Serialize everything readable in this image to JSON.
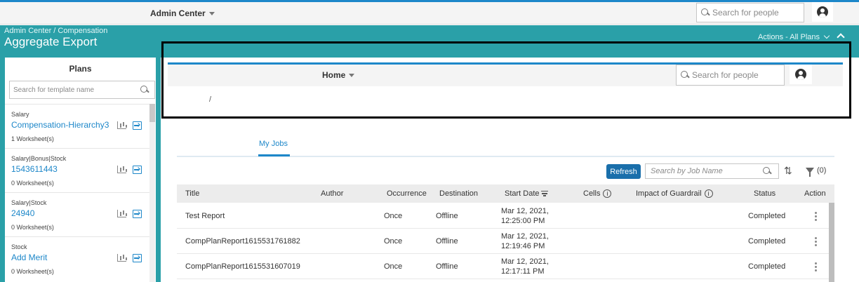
{
  "shell": {
    "title": "Admin Center",
    "search_placeholder": "Search for people"
  },
  "header": {
    "breadcrumb": "Admin Center / Compensation",
    "title": "Aggregate Export",
    "actions_label": "Actions - All Plans"
  },
  "plans": {
    "title": "Plans",
    "search_placeholder": "Search for template name",
    "items": [
      {
        "category": "Salary",
        "name": "Compensation-Hierarchy3",
        "worksheets": "1 Worksheet(s)"
      },
      {
        "category": "Salary|Bonus|Stock",
        "name": "1543611443",
        "worksheets": "0 Worksheet(s)"
      },
      {
        "category": "Salary|Stock",
        "name": "24940",
        "worksheets": "0 Worksheet(s)"
      },
      {
        "category": "Stock",
        "name": "Add Merit",
        "worksheets": "0 Worksheet(s)"
      }
    ]
  },
  "inner": {
    "title": "Home",
    "search_placeholder": "Search for people",
    "breadcrumb_separator": "/"
  },
  "tabs": {
    "my_jobs": "My Jobs"
  },
  "toolbar": {
    "refresh": "Refresh",
    "search_placeholder": "Search by Job Name",
    "sort_icon": "⇅",
    "filter_count": "(0)"
  },
  "table": {
    "columns": {
      "title": "Title",
      "author": "Author",
      "occurrence": "Occurrence",
      "destination": "Destination",
      "start_date": "Start Date",
      "cells": "Cells",
      "guardrail": "Impact of Guardrail",
      "status": "Status",
      "action": "Action"
    },
    "info_glyph": "i",
    "rows": [
      {
        "title": "Test Report",
        "author": "",
        "occurrence": "Once",
        "destination": "Offline",
        "date_line1": "Mar 12, 2021,",
        "date_line2": "12:25:00 PM",
        "cells": "",
        "guardrail": "",
        "status": "Completed"
      },
      {
        "title": "CompPlanReport1615531761882",
        "author": "",
        "occurrence": "Once",
        "destination": "Offline",
        "date_line1": "Mar 12, 2021,",
        "date_line2": "12:19:46 PM",
        "cells": "",
        "guardrail": "",
        "status": "Completed"
      },
      {
        "title": "CompPlanReport1615531607019",
        "author": "",
        "occurrence": "Once",
        "destination": "Offline",
        "date_line1": "Mar 12, 2021,",
        "date_line2": "12:17:11 PM",
        "cells": "",
        "guardrail": "",
        "status": "Completed"
      }
    ]
  },
  "colors": {
    "teal_header": "#2aa0a8",
    "accent_blue": "#1d87c9",
    "button_blue": "#1a6fab"
  }
}
